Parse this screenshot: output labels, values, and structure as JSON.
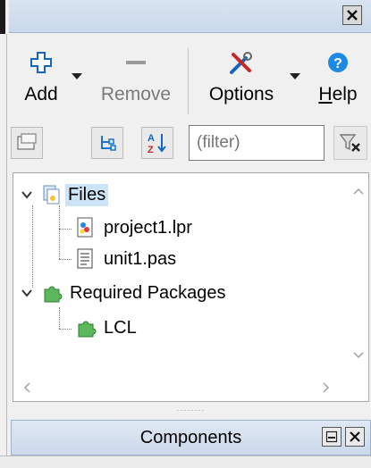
{
  "toolbar": {
    "add_label": "Add",
    "remove_label": "Remove",
    "options_label": "Options",
    "help_label_pre": "",
    "help_label_u": "H",
    "help_label_post": "elp"
  },
  "filter": {
    "placeholder": "(filter)"
  },
  "tree": {
    "files_label": "Files",
    "project_file": "project1.lpr",
    "unit_file": "unit1.pas",
    "required_label": "Required Packages",
    "lcl_label": "LCL"
  },
  "components": {
    "title": "Components"
  },
  "icons": {
    "close": "close-icon",
    "add": "plus-icon",
    "remove": "minus-icon",
    "options": "tools-icon",
    "help": "help-icon",
    "files": "files-icon",
    "package": "puzzle-icon"
  },
  "colors": {
    "selection": "#cce4f7",
    "accent_blue": "#1e88e5",
    "package_green": "#5cb85c"
  }
}
